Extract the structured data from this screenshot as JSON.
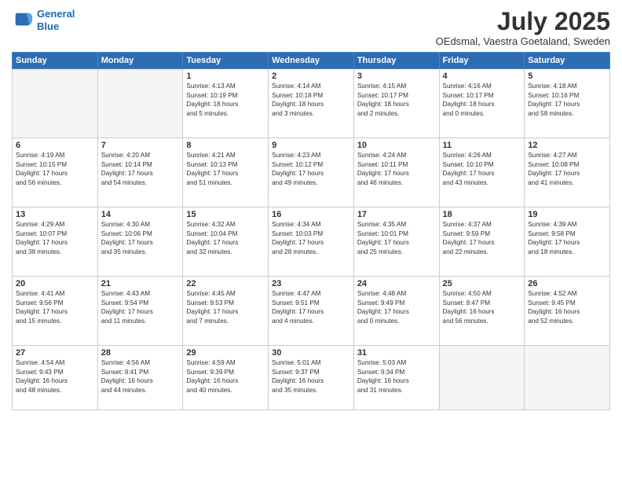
{
  "logo": {
    "line1": "General",
    "line2": "Blue"
  },
  "title": "July 2025",
  "location": "OEdsmal, Vaestra Goetaland, Sweden",
  "headers": [
    "Sunday",
    "Monday",
    "Tuesday",
    "Wednesday",
    "Thursday",
    "Friday",
    "Saturday"
  ],
  "weeks": [
    [
      {
        "day": "",
        "info": ""
      },
      {
        "day": "",
        "info": ""
      },
      {
        "day": "1",
        "info": "Sunrise: 4:13 AM\nSunset: 10:19 PM\nDaylight: 18 hours\nand 5 minutes."
      },
      {
        "day": "2",
        "info": "Sunrise: 4:14 AM\nSunset: 10:18 PM\nDaylight: 18 hours\nand 3 minutes."
      },
      {
        "day": "3",
        "info": "Sunrise: 4:15 AM\nSunset: 10:17 PM\nDaylight: 18 hours\nand 2 minutes."
      },
      {
        "day": "4",
        "info": "Sunrise: 4:16 AM\nSunset: 10:17 PM\nDaylight: 18 hours\nand 0 minutes."
      },
      {
        "day": "5",
        "info": "Sunrise: 4:18 AM\nSunset: 10:16 PM\nDaylight: 17 hours\nand 58 minutes."
      }
    ],
    [
      {
        "day": "6",
        "info": "Sunrise: 4:19 AM\nSunset: 10:15 PM\nDaylight: 17 hours\nand 56 minutes."
      },
      {
        "day": "7",
        "info": "Sunrise: 4:20 AM\nSunset: 10:14 PM\nDaylight: 17 hours\nand 54 minutes."
      },
      {
        "day": "8",
        "info": "Sunrise: 4:21 AM\nSunset: 10:13 PM\nDaylight: 17 hours\nand 51 minutes."
      },
      {
        "day": "9",
        "info": "Sunrise: 4:23 AM\nSunset: 10:12 PM\nDaylight: 17 hours\nand 49 minutes."
      },
      {
        "day": "10",
        "info": "Sunrise: 4:24 AM\nSunset: 10:11 PM\nDaylight: 17 hours\nand 46 minutes."
      },
      {
        "day": "11",
        "info": "Sunrise: 4:26 AM\nSunset: 10:10 PM\nDaylight: 17 hours\nand 43 minutes."
      },
      {
        "day": "12",
        "info": "Sunrise: 4:27 AM\nSunset: 10:08 PM\nDaylight: 17 hours\nand 41 minutes."
      }
    ],
    [
      {
        "day": "13",
        "info": "Sunrise: 4:29 AM\nSunset: 10:07 PM\nDaylight: 17 hours\nand 38 minutes."
      },
      {
        "day": "14",
        "info": "Sunrise: 4:30 AM\nSunset: 10:06 PM\nDaylight: 17 hours\nand 35 minutes."
      },
      {
        "day": "15",
        "info": "Sunrise: 4:32 AM\nSunset: 10:04 PM\nDaylight: 17 hours\nand 32 minutes."
      },
      {
        "day": "16",
        "info": "Sunrise: 4:34 AM\nSunset: 10:03 PM\nDaylight: 17 hours\nand 28 minutes."
      },
      {
        "day": "17",
        "info": "Sunrise: 4:35 AM\nSunset: 10:01 PM\nDaylight: 17 hours\nand 25 minutes."
      },
      {
        "day": "18",
        "info": "Sunrise: 4:37 AM\nSunset: 9:59 PM\nDaylight: 17 hours\nand 22 minutes."
      },
      {
        "day": "19",
        "info": "Sunrise: 4:39 AM\nSunset: 9:58 PM\nDaylight: 17 hours\nand 18 minutes."
      }
    ],
    [
      {
        "day": "20",
        "info": "Sunrise: 4:41 AM\nSunset: 9:56 PM\nDaylight: 17 hours\nand 15 minutes."
      },
      {
        "day": "21",
        "info": "Sunrise: 4:43 AM\nSunset: 9:54 PM\nDaylight: 17 hours\nand 11 minutes."
      },
      {
        "day": "22",
        "info": "Sunrise: 4:45 AM\nSunset: 9:53 PM\nDaylight: 17 hours\nand 7 minutes."
      },
      {
        "day": "23",
        "info": "Sunrise: 4:47 AM\nSunset: 9:51 PM\nDaylight: 17 hours\nand 4 minutes."
      },
      {
        "day": "24",
        "info": "Sunrise: 4:48 AM\nSunset: 9:49 PM\nDaylight: 17 hours\nand 0 minutes."
      },
      {
        "day": "25",
        "info": "Sunrise: 4:50 AM\nSunset: 9:47 PM\nDaylight: 16 hours\nand 56 minutes."
      },
      {
        "day": "26",
        "info": "Sunrise: 4:52 AM\nSunset: 9:45 PM\nDaylight: 16 hours\nand 52 minutes."
      }
    ],
    [
      {
        "day": "27",
        "info": "Sunrise: 4:54 AM\nSunset: 9:43 PM\nDaylight: 16 hours\nand 48 minutes."
      },
      {
        "day": "28",
        "info": "Sunrise: 4:56 AM\nSunset: 9:41 PM\nDaylight: 16 hours\nand 44 minutes."
      },
      {
        "day": "29",
        "info": "Sunrise: 4:59 AM\nSunset: 9:39 PM\nDaylight: 16 hours\nand 40 minutes."
      },
      {
        "day": "30",
        "info": "Sunrise: 5:01 AM\nSunset: 9:37 PM\nDaylight: 16 hours\nand 35 minutes."
      },
      {
        "day": "31",
        "info": "Sunrise: 5:03 AM\nSunset: 9:34 PM\nDaylight: 16 hours\nand 31 minutes."
      },
      {
        "day": "",
        "info": ""
      },
      {
        "day": "",
        "info": ""
      }
    ]
  ]
}
